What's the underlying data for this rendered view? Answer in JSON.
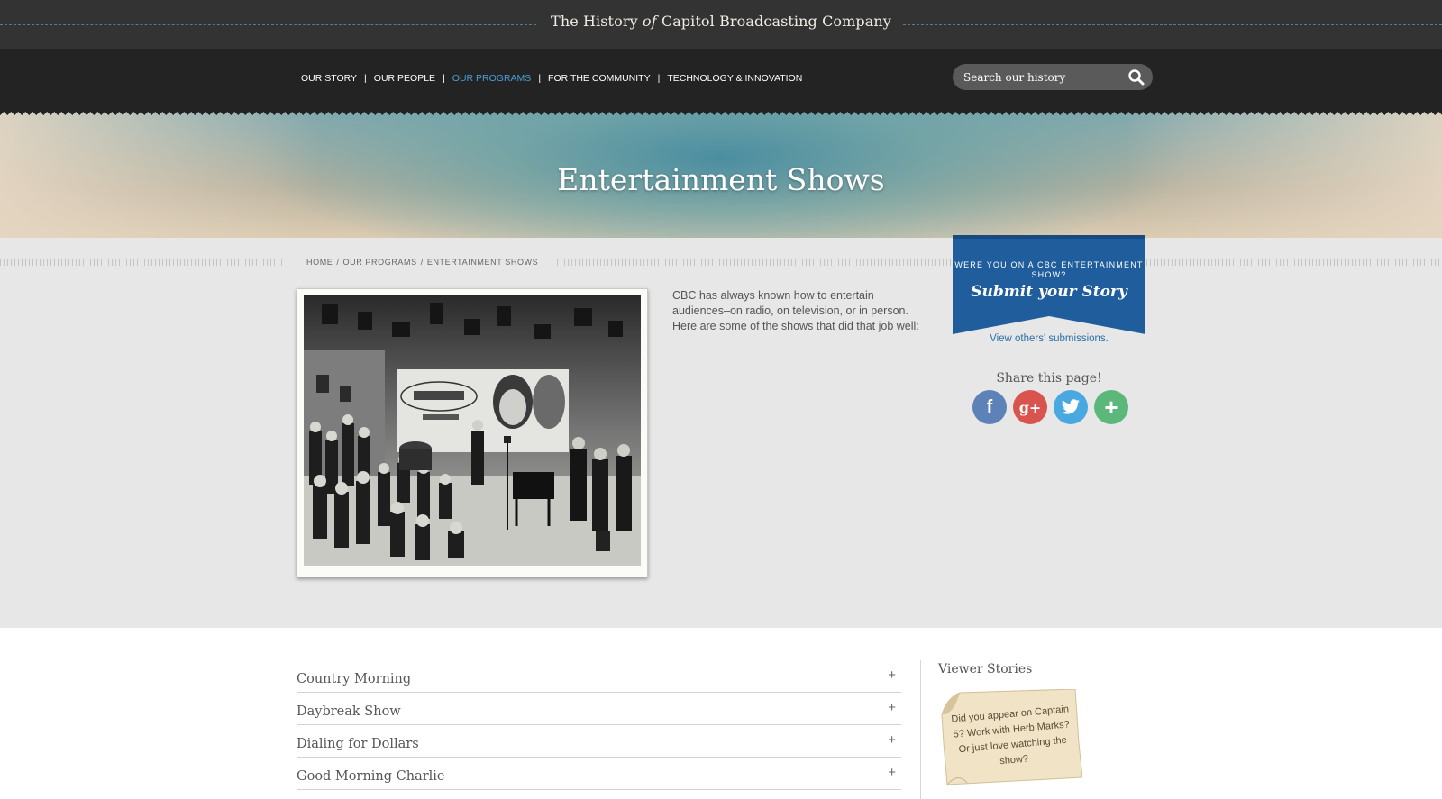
{
  "site": {
    "title_pre": "The History ",
    "title_of": "of",
    "title_post": " Capitol Broadcasting Company"
  },
  "nav": {
    "items": [
      {
        "label": "OUR STORY",
        "active": false
      },
      {
        "label": "OUR PEOPLE",
        "active": false
      },
      {
        "label": "OUR PROGRAMS",
        "active": true
      },
      {
        "label": "FOR THE COMMUNITY",
        "active": false
      },
      {
        "label": "TECHNOLOGY & INNOVATION",
        "active": false
      }
    ],
    "separator": "|",
    "search_placeholder": "Search our history",
    "search_icon": "magnifier-icon"
  },
  "hero": {
    "title": "Entertainment Shows"
  },
  "breadcrumb": {
    "items": [
      "HOME",
      "OUR PROGRAMS",
      "ENTERTAINMENT SHOWS"
    ],
    "separator": "/"
  },
  "intro": {
    "text": "CBC has always known how to entertain audiences–on radio, on television, or in person. Here are some of the shows that did that job well:"
  },
  "submit": {
    "kicker": "WERE YOU ON A CBC ENTERTAINMENT SHOW?",
    "title": "Submit your Story",
    "view_link": "View others' submissions."
  },
  "share": {
    "title": "Share this page!",
    "buttons": [
      {
        "name": "facebook-icon",
        "glyph": "f"
      },
      {
        "name": "google-plus-icon",
        "glyph": "g+"
      },
      {
        "name": "twitter-icon",
        "glyph": ""
      },
      {
        "name": "plus-icon",
        "glyph": "+"
      }
    ]
  },
  "shows": {
    "items": [
      {
        "label": "Country Morning",
        "toggle": "+"
      },
      {
        "label": "Daybreak Show",
        "toggle": "+"
      },
      {
        "label": "Dialing for Dollars",
        "toggle": "+"
      },
      {
        "label": "Good Morning Charlie",
        "toggle": "+"
      }
    ]
  },
  "viewer_stories": {
    "title": "Viewer Stories",
    "note": "Did you appear on Captain 5? Work with Herb Marks? Or just love watching the show?"
  },
  "colors": {
    "topbar": "#333333",
    "navbar": "#232323",
    "nav_active": "#4a9fd8",
    "banner_blue": "#1f5d9c",
    "link_blue": "#2d6fa5",
    "page_gray": "#e7e7e7"
  }
}
